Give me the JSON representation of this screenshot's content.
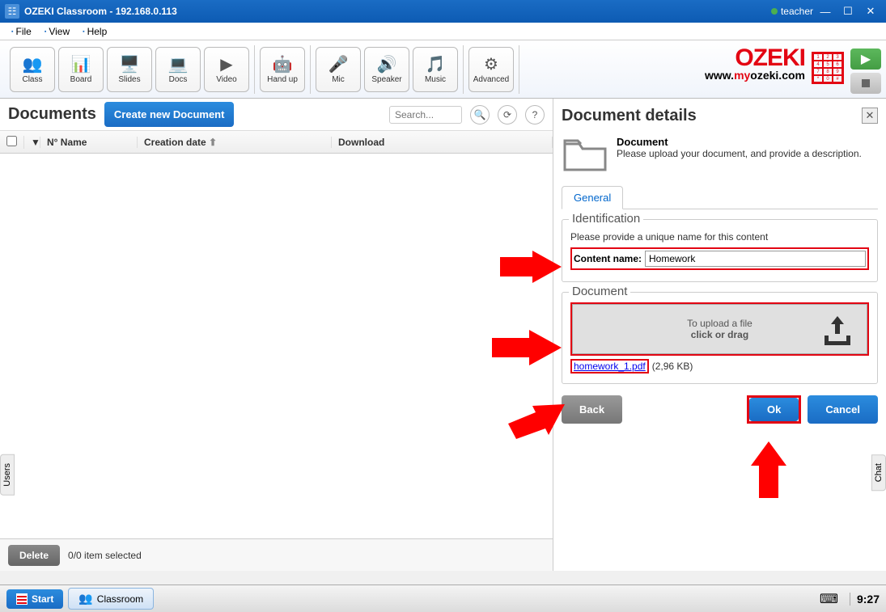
{
  "titlebar": {
    "app": "OZEKI Classroom",
    "ip": "192.168.0.113",
    "user": "teacher"
  },
  "menu": {
    "file": "File",
    "view": "View",
    "help": "Help"
  },
  "toolbar": {
    "class": "Class",
    "board": "Board",
    "slides": "Slides",
    "docs": "Docs",
    "video": "Video",
    "handup": "Hand up",
    "mic": "Mic",
    "speaker": "Speaker",
    "music": "Music",
    "advanced": "Advanced"
  },
  "logo": {
    "text": "OZEKI",
    "url_pre": "www.",
    "url_my": "my",
    "url_post": "ozeki.com"
  },
  "left": {
    "title": "Documents",
    "create": "Create new Document",
    "search_placeholder": "Search...",
    "th_no_name": "N° Name",
    "th_date": "Creation date",
    "th_download": "Download",
    "delete": "Delete",
    "selection": "0/0 item selected",
    "side_tab": "Users"
  },
  "right": {
    "title": "Document details",
    "info_title": "Document",
    "info_desc": "Please upload your document, and provide a description.",
    "tab_general": "General",
    "legend_ident": "Identification",
    "ident_desc": "Please provide a unique name for this content",
    "content_label": "Content name:",
    "content_value": "Homework",
    "legend_doc": "Document",
    "upload_line1": "To upload a file",
    "upload_line2": "click or drag",
    "file_name": "homework_1.pdf",
    "file_size": "(2,96 KB)",
    "back": "Back",
    "ok": "Ok",
    "cancel": "Cancel",
    "side_tab": "Chat"
  },
  "taskbar": {
    "start": "Start",
    "classroom": "Classroom",
    "time": "9:27"
  }
}
